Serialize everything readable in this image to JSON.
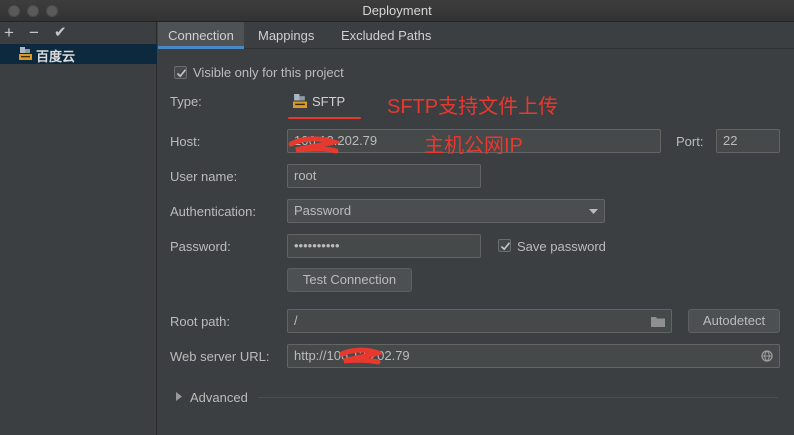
{
  "window": {
    "title": "Deployment"
  },
  "sidebar": {
    "toolbar": {
      "add_glyph": "+",
      "remove_glyph": "−",
      "check_glyph": "✔"
    },
    "servers": [
      {
        "label": "百度云",
        "icon": "sftp-server-icon"
      }
    ]
  },
  "tabs": [
    {
      "label": "Connection",
      "active": true
    },
    {
      "label": "Mappings",
      "active": false
    },
    {
      "label": "Excluded Paths",
      "active": false
    }
  ],
  "form": {
    "visible_only_label": "Visible only for this project",
    "visible_only_checked": true,
    "type_label": "Type:",
    "type_value": "SFTP",
    "host_label": "Host:",
    "host_value": "106.13.202.79",
    "port_label": "Port:",
    "port_value": "22",
    "username_label": "User name:",
    "username_value": "root",
    "auth_label": "Authentication:",
    "auth_value": "Password",
    "password_label": "Password:",
    "password_value": "••••••••••",
    "save_password_label": "Save password",
    "save_password_checked": true,
    "test_connection_label": "Test Connection",
    "root_path_label": "Root path:",
    "root_path_value": "/",
    "autodetect_label": "Autodetect",
    "web_url_label": "Web server URL:",
    "web_url_value": "http://106.13.202.79",
    "advanced_label": "Advanced"
  },
  "annotations": {
    "sftp_note": "SFTP支持文件上传",
    "host_note": "主机公网IP",
    "color": "#e8392f"
  },
  "colors": {
    "background": "#3c3f41",
    "accent": "#4a88c7",
    "selection": "#0d293e"
  }
}
